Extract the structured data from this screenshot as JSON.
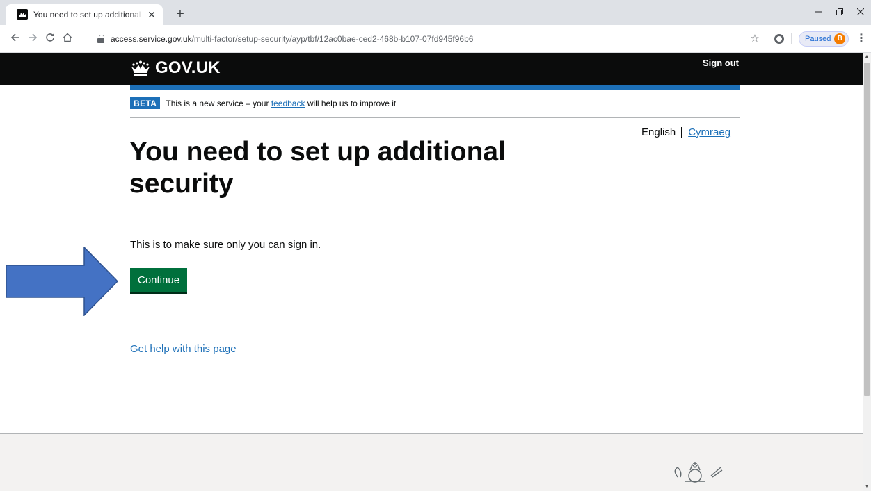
{
  "browser": {
    "tab_title": "You need to set up additional security",
    "tab_close": "✕",
    "new_tab": "+",
    "url_host": "access.service.gov.uk",
    "url_path": "/multi-factor/setup-security/ayp/tbf/12ac0bae-ced2-468b-b107-07fd945f96b6",
    "profile_status": "Paused",
    "profile_initial": "B",
    "icons": [
      "back-arrow-icon",
      "forward-arrow-icon",
      "reload-icon",
      "home-icon",
      "lock-icon",
      "star-icon",
      "extension-icon",
      "kebab-menu-icon"
    ]
  },
  "header": {
    "logo_text": "GOV.UK",
    "sign_out": "Sign out"
  },
  "phase_banner": {
    "tag": "BETA",
    "text_before": "This is a new service – your ",
    "link": "feedback",
    "text_after": " will help us to improve it"
  },
  "language": {
    "current": "English",
    "other": "Cymraeg"
  },
  "main": {
    "heading": "You need to set up additional security",
    "body": "This is to make sure only you can sign in.",
    "continue_label": "Continue",
    "help_link": "Get help with this page"
  },
  "colors": {
    "header_bg": "#0b0c0c",
    "gov_blue": "#1d70b8",
    "button_green": "#00703c",
    "annotation_arrow": "#4472c4"
  }
}
